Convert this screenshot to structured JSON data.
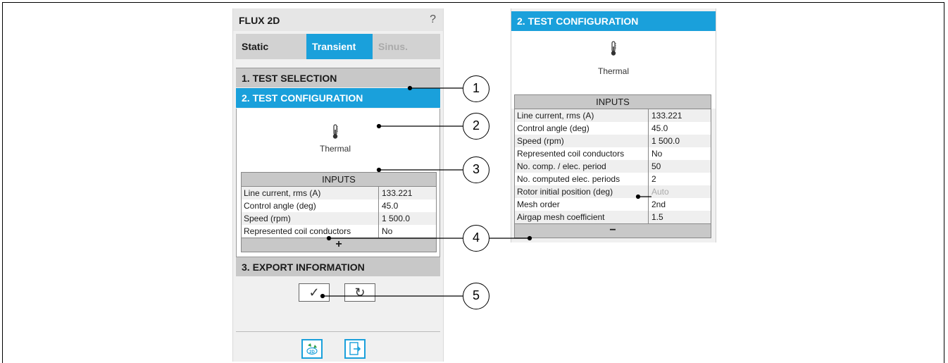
{
  "app": {
    "title": "FLUX 2D",
    "help": "?"
  },
  "tabs": [
    {
      "label": "Static"
    },
    {
      "label": "Transient"
    },
    {
      "label": "Sinus."
    }
  ],
  "sections": {
    "test_selection": "1. TEST SELECTION",
    "test_configuration": "2. TEST CONFIGURATION",
    "export_information": "3. EXPORT INFORMATION"
  },
  "test": {
    "icon": "thermometer-icon",
    "label": "Thermal"
  },
  "inputs_title": "INPUTS",
  "inputs_collapsed": [
    {
      "label": "Line current, rms (A)",
      "value": "133.221"
    },
    {
      "label": "Control angle (deg)",
      "value": "45.0"
    },
    {
      "label": "Speed (rpm)",
      "value": "1 500.0"
    },
    {
      "label": "Represented coil conductors",
      "value": "No"
    }
  ],
  "inputs_expanded": [
    {
      "label": "Line current, rms (A)",
      "value": "133.221"
    },
    {
      "label": "Control angle (deg)",
      "value": "45.0"
    },
    {
      "label": "Speed (rpm)",
      "value": "1 500.0"
    },
    {
      "label": "Represented coil conductors",
      "value": "No"
    },
    {
      "label": "No. comp. / elec. period",
      "value": "50"
    },
    {
      "label": "No. computed elec. periods",
      "value": "2"
    },
    {
      "label": "Rotor initial position (deg)",
      "value": "Auto"
    },
    {
      "label": "Mesh order",
      "value": "2nd"
    },
    {
      "label": "Airgap mesh coefficient",
      "value": "1.5"
    }
  ],
  "expand_symbol": "+",
  "collapse_symbol": "−",
  "buttons": {
    "check": "✓",
    "reset": "↻"
  },
  "callouts": [
    "1",
    "2",
    "3",
    "4",
    "5"
  ],
  "colors": {
    "accent": "#1aa0db",
    "header_grey": "#c8c8c8",
    "panel_bg": "#f0f0f0"
  }
}
